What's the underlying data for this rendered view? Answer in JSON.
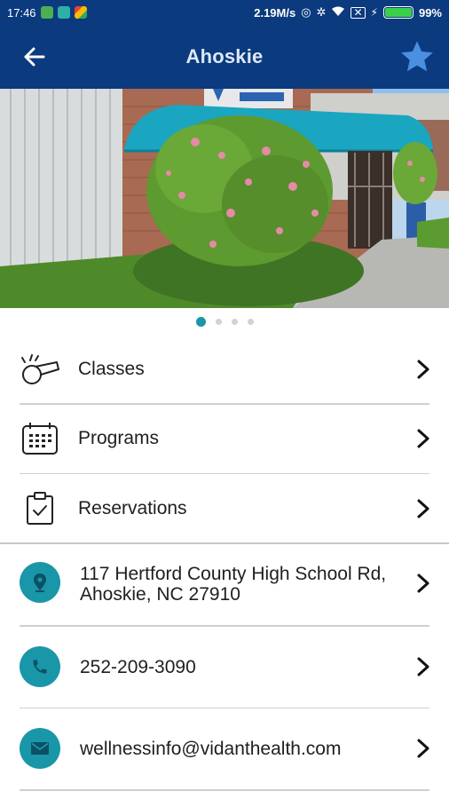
{
  "status_bar": {
    "time": "17:46",
    "net_speed": "2.19M/s",
    "battery": "99%",
    "battery_level": 0.99
  },
  "app_bar": {
    "title": "Ahoskie"
  },
  "carousel": {
    "page_count": 4,
    "active_page": 1
  },
  "menu": [
    {
      "label": "Classes",
      "icon": "whistle-icon"
    },
    {
      "label": "Programs",
      "icon": "calendar-icon"
    },
    {
      "label": "Reservations",
      "icon": "clipboard-check-icon"
    }
  ],
  "contact": {
    "address": "117 Hertford County High School Rd, Ahoskie, NC 27910",
    "phone": "252-209-3090",
    "email": "wellnessinfo@vidanthealth.com"
  },
  "colors": {
    "app_bar": "#0b3a7e",
    "accent": "#1996a8",
    "star": "#4a8fe0"
  }
}
